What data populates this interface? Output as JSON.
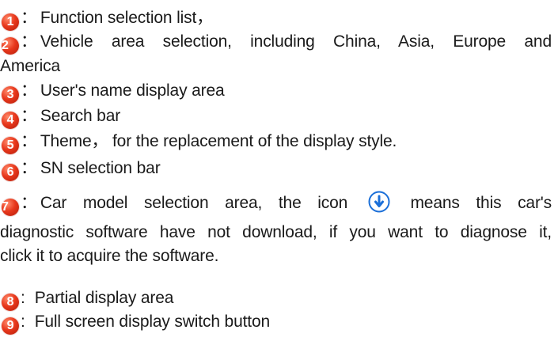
{
  "items": [
    {
      "num": "1",
      "sep": "：",
      "text": "Function selection list，"
    },
    {
      "num": "2",
      "sep": "：",
      "text_line1": "Vehicle area selection, including China, Asia, Europe and",
      "text_line2": "America"
    },
    {
      "num": "3",
      "sep": "：",
      "text": "User's name display area"
    },
    {
      "num": "4",
      "sep": "：",
      "text": "Search bar"
    },
    {
      "num": "5",
      "sep": "：",
      "text": "Theme， for the replacement of the display style."
    },
    {
      "num": "6",
      "sep": "：",
      "text": "SN selection bar"
    },
    {
      "num": "7",
      "sep": "：",
      "text_before_icon": "Car model selection area, the icon",
      "text_after_icon": "means this car's",
      "text_line2": "diagnostic software have not download, if you want to diagnose it,",
      "text_line3": "click it to acquire the software."
    },
    {
      "num": "8",
      "sep": ":",
      "text": "Partial display area"
    },
    {
      "num": "9",
      "sep": ":",
      "text": "Full screen display switch button"
    }
  ],
  "colors": {
    "badge": "#e8381c",
    "download_icon": "#1b6fd8"
  },
  "icons": {
    "download": "download-arrow-circle-icon"
  }
}
